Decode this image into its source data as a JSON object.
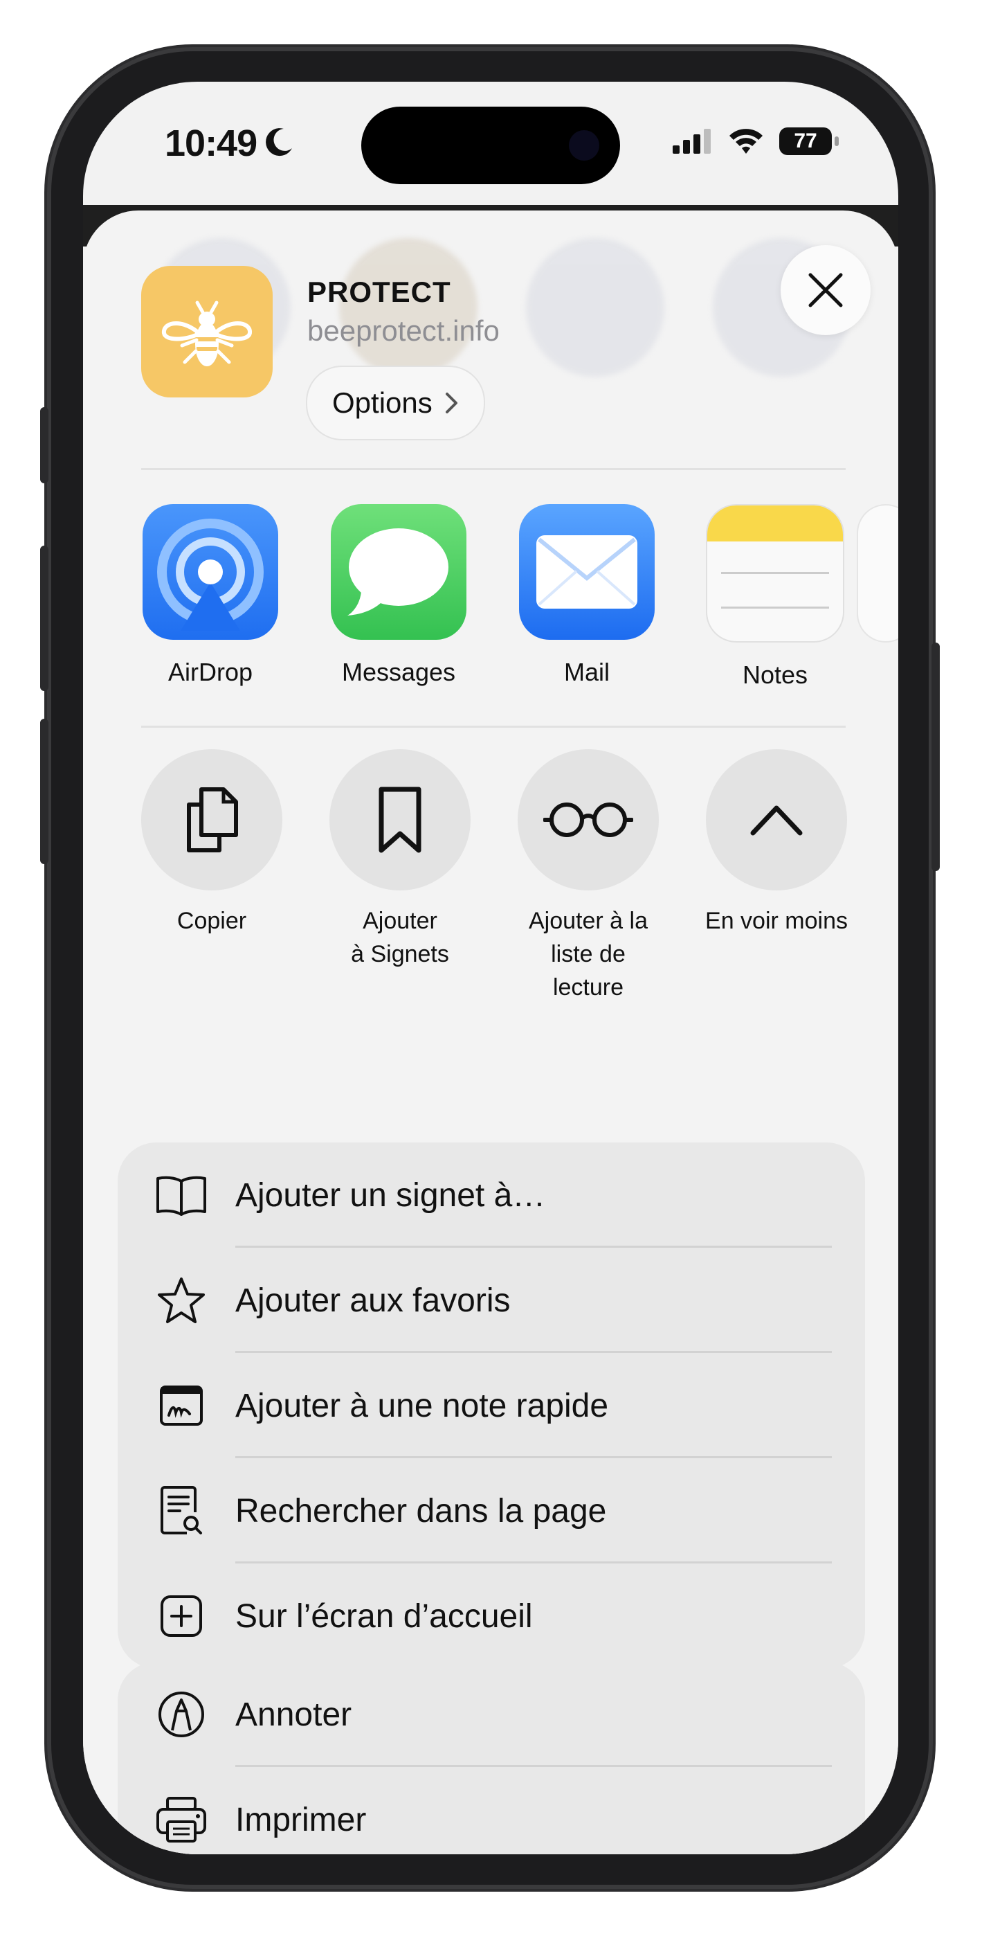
{
  "status": {
    "time": "10:49",
    "battery": "77"
  },
  "header": {
    "title": "PROTECT",
    "url": "beeprotect.info",
    "options_label": "Options"
  },
  "apps": [
    {
      "label": "AirDrop",
      "icon": "airdrop-icon",
      "color": "#2f7cf6"
    },
    {
      "label": "Messages",
      "icon": "messages-icon",
      "color": "#4cd964"
    },
    {
      "label": "Mail",
      "icon": "mail-icon",
      "color": "#2f7cf6"
    },
    {
      "label": "Notes",
      "icon": "notes-icon",
      "color": "#f9d84a"
    }
  ],
  "actions": [
    {
      "label": "Copier",
      "icon": "copy-icon"
    },
    {
      "label": "Ajouter\nà Signets",
      "icon": "bookmark-icon"
    },
    {
      "label": "Ajouter à la\nliste de\nlecture",
      "icon": "glasses-icon"
    },
    {
      "label": "En voir moins",
      "icon": "chevron-up-icon"
    }
  ],
  "menu_group_1": [
    {
      "label": "Ajouter un signet à…",
      "icon": "book-icon"
    },
    {
      "label": "Ajouter aux favoris",
      "icon": "star-icon"
    },
    {
      "label": "Ajouter à une note rapide",
      "icon": "quick-note-icon"
    },
    {
      "label": "Rechercher dans la page",
      "icon": "find-in-page-icon"
    },
    {
      "label": "Sur l’écran d’accueil",
      "icon": "add-square-icon"
    }
  ],
  "menu_group_2": [
    {
      "label": "Annoter",
      "icon": "markup-icon"
    },
    {
      "label": "Imprimer",
      "icon": "printer-icon"
    }
  ]
}
